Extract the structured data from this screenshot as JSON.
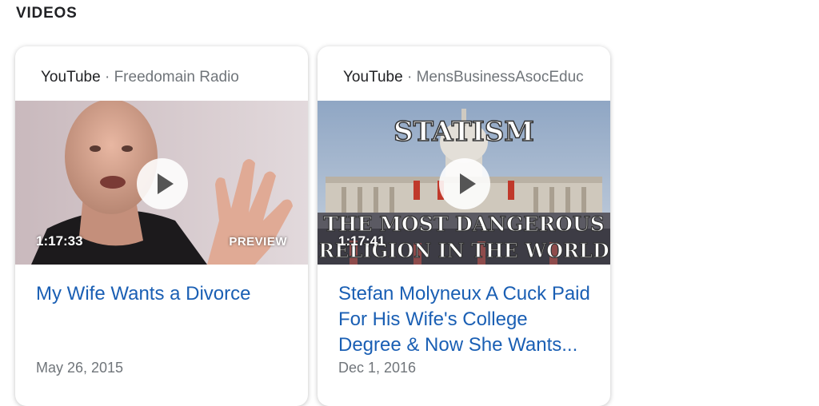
{
  "section": {
    "title": "VIDEOS"
  },
  "videos": [
    {
      "platform": "YouTube",
      "separator": " · ",
      "channel": "Freedomain Radio",
      "duration": "1:17:33",
      "preview_label": "PREVIEW",
      "title": "My Wife Wants a Divorce",
      "date": "May 26, 2015"
    },
    {
      "platform": "YouTube",
      "separator": " · ",
      "channel": "MensBusinessAsocEduc",
      "duration": "1:17:41",
      "thumbnail_text": {
        "top": "STATISM",
        "line1": "THE MOST DANGEROUS",
        "line2": "RELIGION IN THE WORLD"
      },
      "title": "Stefan Molyneux A Cuck Paid For His Wife's College Degree & Now She Wants...",
      "date": "Dec 1, 2016"
    }
  ],
  "icons": {
    "play": "play-icon"
  }
}
